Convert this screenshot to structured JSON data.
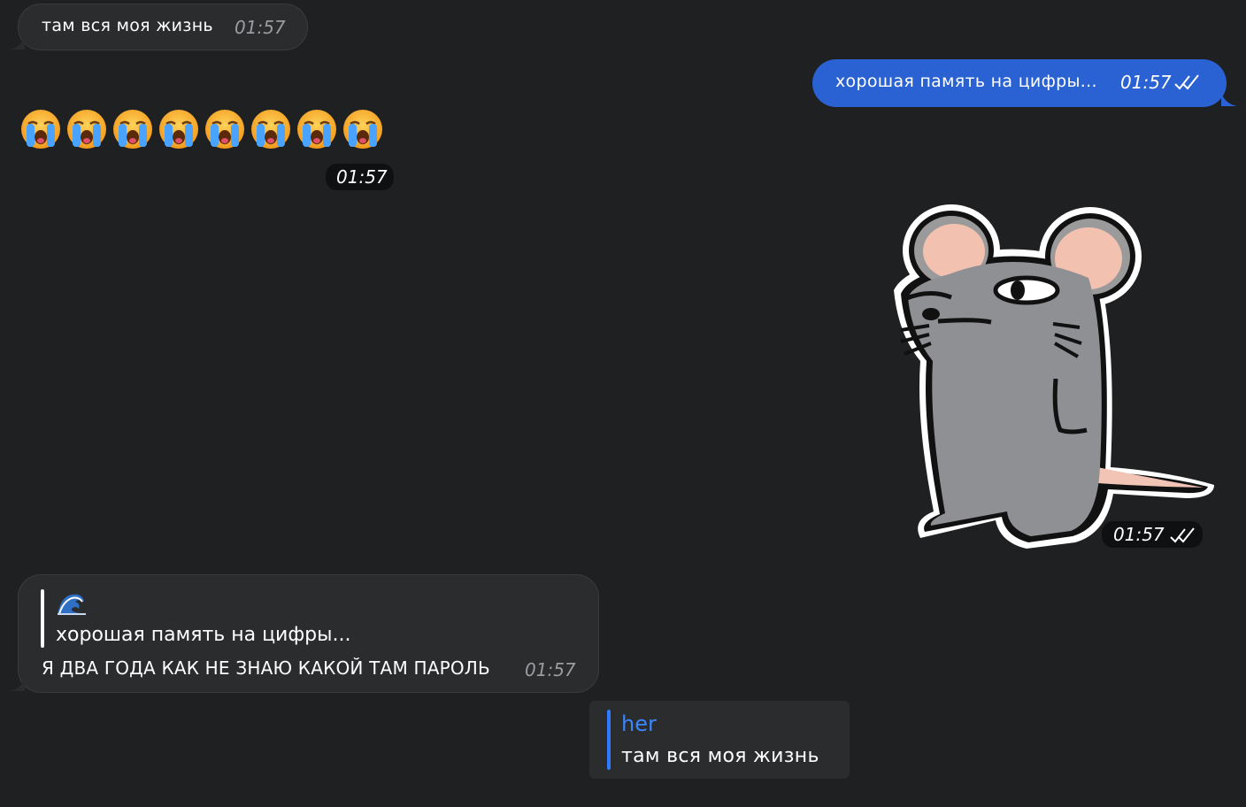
{
  "chat": {
    "messages": [
      {
        "direction": "in",
        "text": "там вся моя жизнь",
        "time": "01:57"
      },
      {
        "direction": "out",
        "text": "хорошая память на цифры...",
        "time": "01:57",
        "status": "read"
      },
      {
        "direction": "in",
        "type": "emoji",
        "emoji": "😭😭😭😭😭😭😭😭",
        "time": "01:57"
      },
      {
        "direction": "out",
        "type": "sticker",
        "sticker": "grey-rat-sticker",
        "time": "01:57",
        "status": "read"
      },
      {
        "direction": "in",
        "reply_to": {
          "icon": "wave-emoji",
          "text": "хорошая память на цифры..."
        },
        "text": "Я ДВА ГОДА КАК НЕ ЗНАЮ КАКОЙ ТАМ ПАРОЛЬ",
        "time": "01:57"
      }
    ]
  },
  "reply_preview": {
    "name": "her",
    "text": "там вся моя жизнь"
  },
  "colors": {
    "background": "#1e2022",
    "bubble_in": "#2b2c2e",
    "bubble_out": "#2a62d4",
    "reply_accent": "#2f7bff",
    "time_muted": "#9a9ca0"
  }
}
